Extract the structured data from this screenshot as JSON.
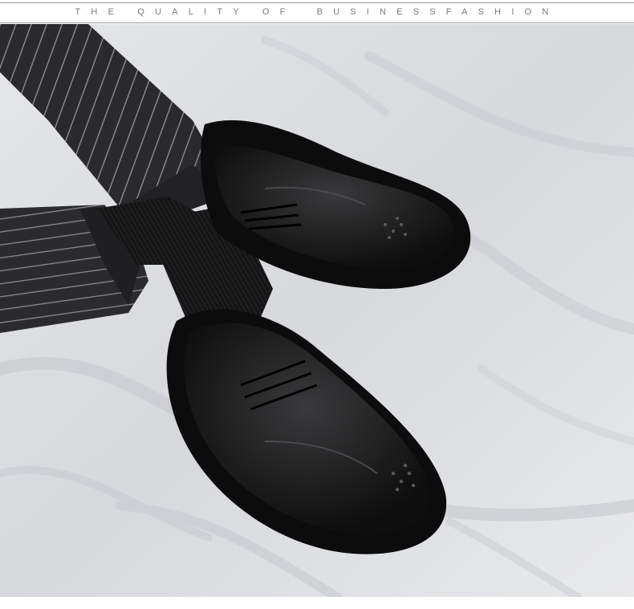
{
  "banner": {
    "part1": "THE QUALITY OF",
    "part2": "BUSINESSFASHION"
  },
  "photo": {
    "subject": "black-brogue-shoes",
    "colors": {
      "sheet": "#d9dbde",
      "leather": "#0f0f10",
      "trouser": "#2a2a2c",
      "pinstripe": "#8c8c90"
    }
  }
}
